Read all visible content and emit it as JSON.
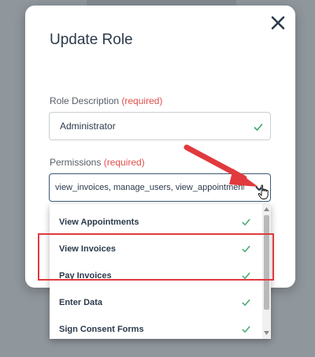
{
  "modal": {
    "title": "Update Role",
    "close_icon": "close-icon"
  },
  "role_description": {
    "label": "Role Description",
    "required": "(required)",
    "value": "Administrator"
  },
  "permissions": {
    "label": "Permissions",
    "required": "(required)",
    "value": "view_invoices, manage_users, view_appointments,..."
  },
  "dropdown": {
    "items": [
      {
        "label": "View Appointments",
        "checked": true
      },
      {
        "label": "View Invoices",
        "checked": true
      },
      {
        "label": "Pay Invoices",
        "checked": true
      },
      {
        "label": "Enter Data",
        "checked": true
      },
      {
        "label": "Sign Consent Forms",
        "checked": true
      }
    ]
  },
  "colors": {
    "accent_check": "#3fa66a",
    "required_text": "#e0504a",
    "annotation_red": "#e03a3e"
  }
}
